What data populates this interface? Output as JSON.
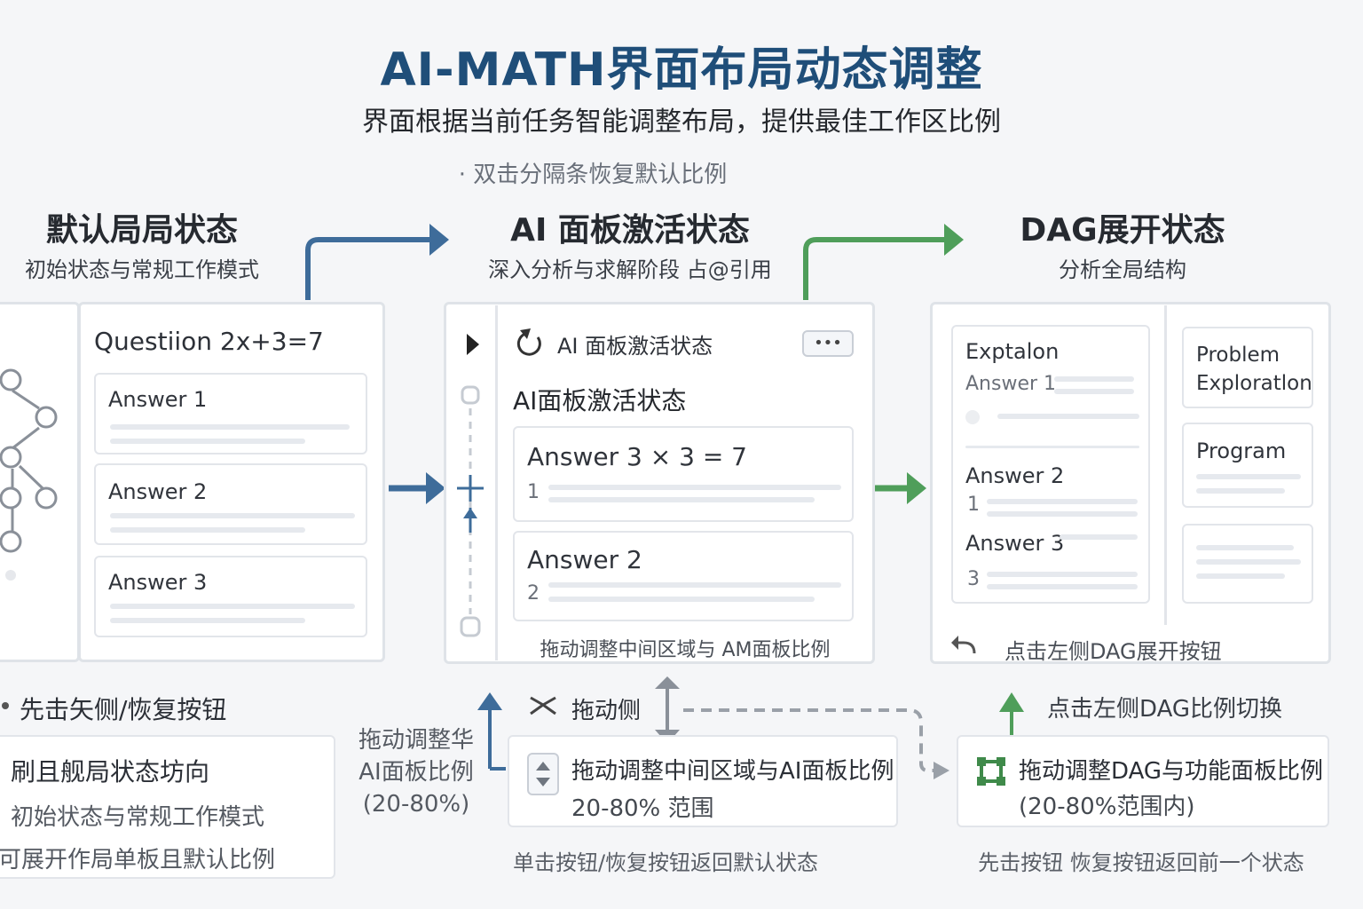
{
  "header": {
    "title": "AI-MATH界面布局动态调整",
    "subtitle": "界面根据当前任务智能调整布局，提供最佳工作区比例",
    "hint": "· 双击分隔条恢复默认比例"
  },
  "states": {
    "default": {
      "title": "默认局局状态",
      "subtitle": "初始状态与常规工作模式",
      "question": "Questiion 2x+3=7",
      "answers": [
        "Answer 1",
        "Answer 2",
        "Answer 3"
      ]
    },
    "ai": {
      "title": "AI 面板激活状态",
      "subtitle": "深入分析与求解阶段  占@引用",
      "panel_header": "AI 面板激活状态",
      "panel_title": "AI面板激活状态",
      "more_label": "•••",
      "answers": [
        {
          "label": "Answer 3 × 3 = 7",
          "num": "1"
        },
        {
          "label": "Answer 2",
          "num": "2"
        }
      ],
      "footer": "拖动调整中间区域与 AM面板比例"
    },
    "dag": {
      "title": "DAG展开状态",
      "subtitle": "分析全局结构",
      "left_items": [
        {
          "label": "Exptalon",
          "sub": "Answer 1"
        },
        {
          "label": "Answer 2",
          "sub": "1"
        },
        {
          "label": "Answer 3",
          "sub": "3"
        }
      ],
      "right_items": [
        "Problem Exploratlon",
        "Program"
      ],
      "footer": "点击左侧DAG展开按钮"
    }
  },
  "bottom": {
    "left_label": "先击矢侧/恢复按钮",
    "left_card": {
      "line1": "刷且舰局状态坊向",
      "line2": "初始状态与常规工作模式",
      "line3": "可展开作局单板且默认比例"
    },
    "mid_left_note": [
      "拖动调整华",
      "AI面板比例",
      "(20-80%)"
    ],
    "mid_drag_label": "拖动侧",
    "mid_card": {
      "line1": "拖动调整中间区域与AI面板比例",
      "line2": "20-80% 范围"
    },
    "mid_footer": "单击按钮/恢复按钮返回默认状态",
    "right_label": "点击左侧DAG比例切换",
    "right_card": {
      "line1": "拖动调整DAG与功能面板比例",
      "line2": "(20-80%范围内)"
    },
    "right_footer": "先击按钮 恢复按钮返回前一个状态"
  },
  "colors": {
    "blue_arrow": "#3e6c9a",
    "green_arrow": "#4f9e5a",
    "title": "#1f4e79"
  }
}
